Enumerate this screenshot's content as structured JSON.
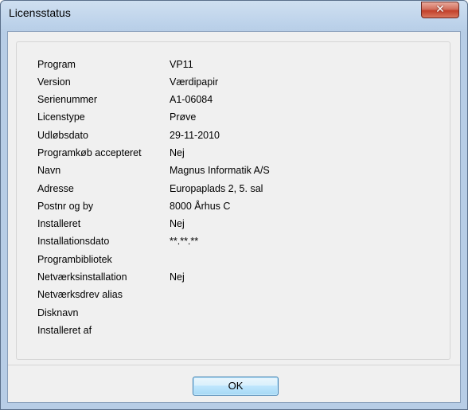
{
  "window": {
    "title": "Licensstatus",
    "close_glyph": "✕"
  },
  "fields": [
    {
      "label": "Program",
      "value": "VP11"
    },
    {
      "label": "Version",
      "value": "Værdipapir"
    },
    {
      "label": "Serienummer",
      "value": "A1-06084"
    },
    {
      "label": "Licenstype",
      "value": "Prøve"
    },
    {
      "label": "Udløbsdato",
      "value": "29-11-2010"
    },
    {
      "label": "Programkøb accepteret",
      "value": "Nej"
    },
    {
      "label": "Navn",
      "value": "Magnus Informatik A/S"
    },
    {
      "label": "Adresse",
      "value": "Europaplads 2, 5. sal"
    },
    {
      "label": "Postnr og by",
      "value": "8000 Århus C"
    },
    {
      "label": "Installeret",
      "value": "Nej"
    },
    {
      "label": "Installationsdato",
      "value": "**.**.**"
    },
    {
      "label": "Programbibliotek",
      "value": ""
    },
    {
      "label": "Netværksinstallation",
      "value": "Nej"
    },
    {
      "label": "Netværksdrev alias",
      "value": ""
    },
    {
      "label": "Disknavn",
      "value": ""
    },
    {
      "label": "Installeret af",
      "value": ""
    }
  ],
  "buttons": {
    "ok_label": "OK"
  }
}
